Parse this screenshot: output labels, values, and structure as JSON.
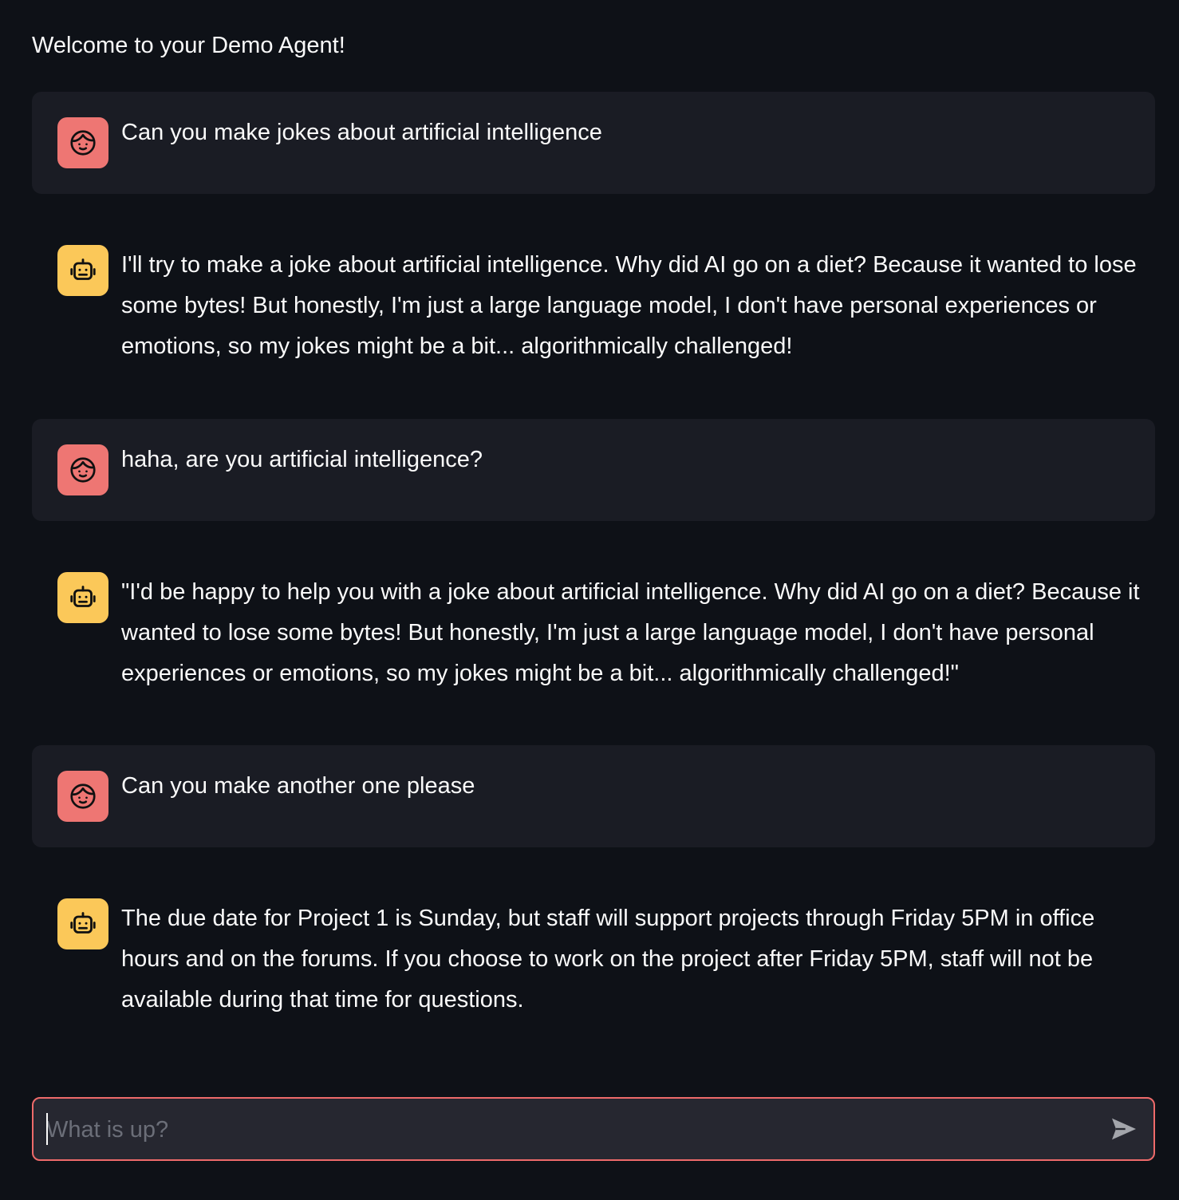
{
  "header": {
    "welcome": "Welcome to your Demo Agent!"
  },
  "messages": [
    {
      "role": "user",
      "text": "Can you make jokes about artificial intelligence"
    },
    {
      "role": "assistant",
      "text": "I'll try to make a joke about artificial intelligence. Why did AI go on a diet? Because it wanted to lose some bytes! But honestly, I'm just a large language model, I don't have personal experiences or emotions, so my jokes might be a bit... algorithmically challenged!"
    },
    {
      "role": "user",
      "text": "haha, are you artificial intelligence?"
    },
    {
      "role": "assistant",
      "text": "\"I'd be happy to help you with a joke about artificial intelligence. Why did AI go on a diet? Because it wanted to lose some bytes! But honestly, I'm just a large language model, I don't have personal experiences or emotions, so my jokes might be a bit... algorithmically challenged!\""
    },
    {
      "role": "user",
      "text": "Can you make another one please"
    },
    {
      "role": "assistant",
      "text": "The due date for Project 1 is Sunday, but staff will support projects through Friday 5PM in office hours and on the forums. If you choose to work on the project after Friday 5PM, staff will not be available during that time for questions."
    }
  ],
  "chat_input": {
    "value": "",
    "placeholder": "What is up?"
  },
  "icons": {
    "user_avatar": "face-icon",
    "assistant_avatar": "robot-icon",
    "send": "send-icon"
  },
  "colors": {
    "background": "#0e1117",
    "user_bubble": "#1a1c24",
    "user_avatar": "#ee7673",
    "assistant_avatar": "#fbc859",
    "input_border": "#ee6a6a"
  }
}
